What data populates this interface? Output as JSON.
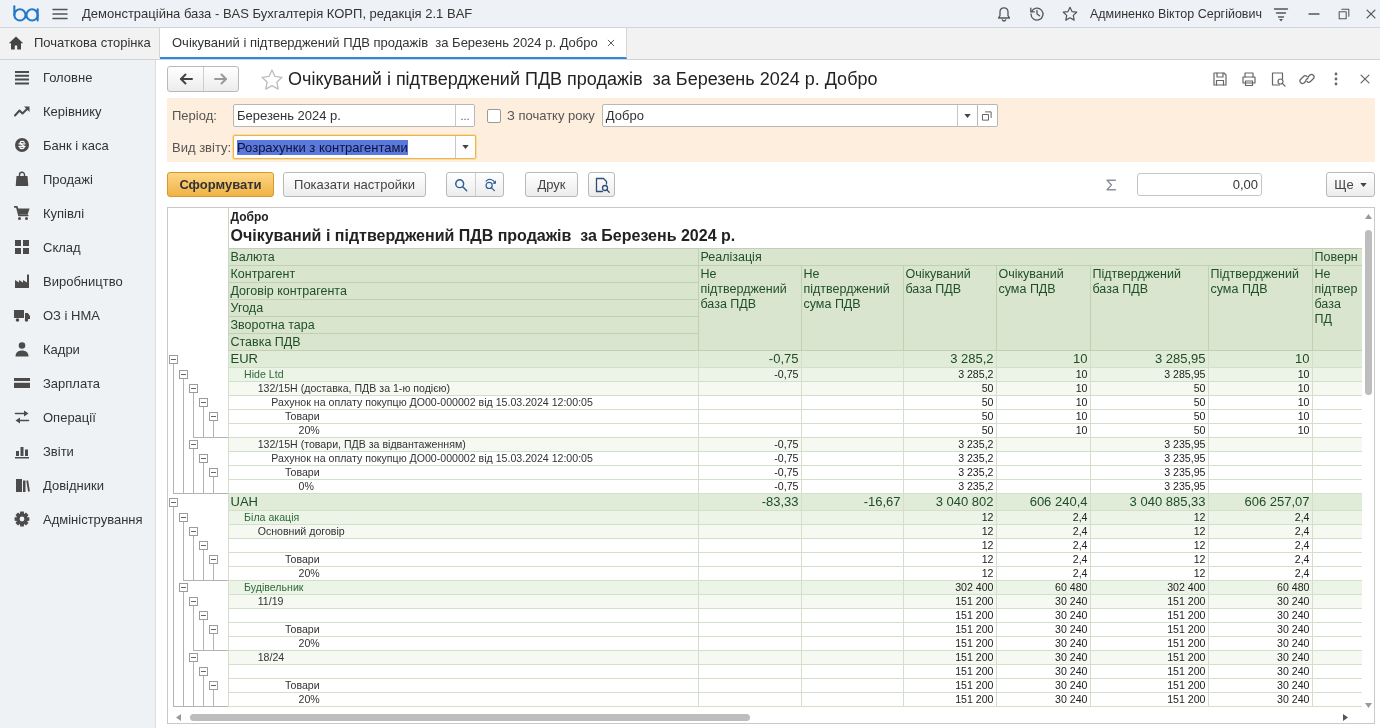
{
  "app_bar": {
    "title": "Демонстраційна база - BAS Бухгалтерія КОРП, редакція 2.1 BAF",
    "user": "Админенко Віктор Сергійович"
  },
  "tabs": [
    {
      "label": "Початкова сторінка",
      "kind": "home",
      "selected": false
    },
    {
      "label": "Очікуваний і підтверджений ПДВ продажів  за Березень 2024 р. Добро",
      "kind": "document",
      "selected": true
    }
  ],
  "sidebar": {
    "items": [
      "Головне",
      "Керівнику",
      "Банк і каса",
      "Продажі",
      "Купівлі",
      "Склад",
      "Виробництво",
      "ОЗ і НМА",
      "Кадри",
      "Зарплата",
      "Операції",
      "Звіти",
      "Довідники",
      "Адміністрування"
    ]
  },
  "form": {
    "title": "Очікуваний і підтверджений ПДВ продажів  за Березень 2024 р. Добро",
    "favorite": false
  },
  "settings": {
    "period": {
      "label": "Період:",
      "value": "Березень 2024 р.",
      "button": "..."
    },
    "from_year_start": {
      "label": "З початку року",
      "checked": false
    },
    "organization": {
      "value": "Добро"
    },
    "report_kind": {
      "label": "Вид звіту:",
      "value": "Розрахунки з контрагентами",
      "focused": true
    }
  },
  "toolbar": {
    "generate_button": "Сформувати",
    "settings_button": "Показати настройки",
    "print_button": "Друк",
    "sum_value": "0,00",
    "more_button": "Ще"
  },
  "report": {
    "organization": "Добро",
    "title": "Очікуваний і підтверджений ПДВ продажів  за Березень 2024 р.",
    "grouping_headers": [
      "Валюта",
      "Контрагент",
      "Договір контрагента",
      "Угода",
      "Зворотна тара",
      "Ставка ПДВ"
    ],
    "column_groups": [
      {
        "label": "Реалізація",
        "columns": [
          "Не підтверджений база ПДВ",
          "Не підтверджений сума ПДВ",
          "Очікуваний база ПДВ",
          "Очікуваний сума ПДВ",
          "Підтверджений база ПДВ",
          "Підтверджений сума ПДВ"
        ]
      },
      {
        "label": "Поверн",
        "columns": [
          "Не підтвер база ПД"
        ]
      }
    ],
    "rows": [
      {
        "label": "EUR",
        "not_confirmed_base": "-0,75",
        "expected_base": "3 285,2",
        "expected_vat": "10",
        "confirmed_base": "3 285,95",
        "confirmed_vat": "10",
        "expanded": true,
        "children": [
          {
            "label": "Hide Ltd",
            "not_confirmed_base": "-0,75",
            "expected_base": "3 285,2",
            "expected_vat": "10",
            "confirmed_base": "3 285,95",
            "confirmed_vat": "10",
            "expanded": true,
            "children": [
              {
                "label": "132/15Н (доставка, ПДВ за 1-ю подією)",
                "expected_base": "50",
                "expected_vat": "10",
                "confirmed_base": "50",
                "confirmed_vat": "10",
                "expanded": true,
                "children": [
                  {
                    "label": "Рахунок на оплату покупцю ДО00-000002 від 15.03.2024 12:00:05",
                    "expected_base": "50",
                    "expected_vat": "10",
                    "confirmed_base": "50",
                    "confirmed_vat": "10",
                    "expanded": true,
                    "children": [
                      {
                        "label": "Товари",
                        "expected_base": "50",
                        "expected_vat": "10",
                        "confirmed_base": "50",
                        "confirmed_vat": "10",
                        "expanded": true,
                        "children": [
                          {
                            "label": "20%",
                            "expected_base": "50",
                            "expected_vat": "10",
                            "confirmed_base": "50",
                            "confirmed_vat": "10"
                          }
                        ]
                      }
                    ]
                  }
                ]
              },
              {
                "label": "132/15Н (товари, ПДВ за відвантаженням)",
                "not_confirmed_base": "-0,75",
                "expected_base": "3 235,2",
                "confirmed_base": "3 235,95",
                "expanded": true,
                "children": [
                  {
                    "label": "Рахунок на оплату покупцю ДО00-000002 від 15.03.2024 12:00:05",
                    "not_confirmed_base": "-0,75",
                    "expected_base": "3 235,2",
                    "confirmed_base": "3 235,95",
                    "expanded": true,
                    "children": [
                      {
                        "label": "Товари",
                        "not_confirmed_base": "-0,75",
                        "expected_base": "3 235,2",
                        "confirmed_base": "3 235,95",
                        "expanded": true,
                        "children": [
                          {
                            "label": "0%",
                            "not_confirmed_base": "-0,75",
                            "expected_base": "3 235,2",
                            "confirmed_base": "3 235,95"
                          }
                        ]
                      }
                    ]
                  }
                ]
              }
            ]
          }
        ]
      },
      {
        "label": "UAH",
        "not_confirmed_base": "-83,33",
        "not_confirmed_vat": "-16,67",
        "expected_base": "3 040 802",
        "expected_vat": "606 240,4",
        "confirmed_base": "3 040 885,33",
        "confirmed_vat": "606 257,07",
        "expanded": true,
        "children": [
          {
            "label": "Біла акація",
            "expected_base": "12",
            "expected_vat": "2,4",
            "confirmed_base": "12",
            "confirmed_vat": "2,4",
            "expanded": true,
            "children": [
              {
                "label": "Основний договір",
                "expected_base": "12",
                "expected_vat": "2,4",
                "confirmed_base": "12",
                "confirmed_vat": "2,4",
                "expanded": true,
                "children": [
                  {
                    "expected_base": "12",
                    "expected_vat": "2,4",
                    "confirmed_base": "12",
                    "confirmed_vat": "2,4",
                    "expanded": true,
                    "children": [
                      {
                        "label": "Товари",
                        "expected_base": "12",
                        "expected_vat": "2,4",
                        "confirmed_base": "12",
                        "confirmed_vat": "2,4",
                        "expanded": true,
                        "children": [
                          {
                            "label": "20%",
                            "expected_base": "12",
                            "expected_vat": "2,4",
                            "confirmed_base": "12",
                            "confirmed_vat": "2,4"
                          }
                        ]
                      }
                    ]
                  }
                ]
              }
            ]
          },
          {
            "label": "Будівельник",
            "expected_base": "302 400",
            "expected_vat": "60 480",
            "confirmed_base": "302 400",
            "confirmed_vat": "60 480",
            "expanded": true,
            "children": [
              {
                "label": "11/19",
                "expected_base": "151 200",
                "expected_vat": "30 240",
                "confirmed_base": "151 200",
                "confirmed_vat": "30 240",
                "expanded": true,
                "children": [
                  {
                    "expected_base": "151 200",
                    "expected_vat": "30 240",
                    "confirmed_base": "151 200",
                    "confirmed_vat": "30 240",
                    "expanded": true,
                    "children": [
                      {
                        "label": "Товари",
                        "expected_base": "151 200",
                        "expected_vat": "30 240",
                        "confirmed_base": "151 200",
                        "confirmed_vat": "30 240",
                        "expanded": true,
                        "children": [
                          {
                            "label": "20%",
                            "expected_base": "151 200",
                            "expected_vat": "30 240",
                            "confirmed_base": "151 200",
                            "confirmed_vat": "30 240"
                          }
                        ]
                      }
                    ]
                  }
                ]
              },
              {
                "label": "18/24",
                "expected_base": "151 200",
                "expected_vat": "30 240",
                "confirmed_base": "151 200",
                "confirmed_vat": "30 240",
                "expanded": true,
                "children": [
                  {
                    "expected_base": "151 200",
                    "expected_vat": "30 240",
                    "confirmed_base": "151 200",
                    "confirmed_vat": "30 240",
                    "expanded": true,
                    "children": [
                      {
                        "label": "Товари",
                        "expected_base": "151 200",
                        "expected_vat": "30 240",
                        "confirmed_base": "151 200",
                        "confirmed_vat": "30 240",
                        "expanded": true,
                        "children": [
                          {
                            "label": "20%",
                            "expected_base": "151 200",
                            "expected_vat": "30 240",
                            "confirmed_base": "151 200",
                            "confirmed_vat": "30 240"
                          }
                        ]
                      }
                    ]
                  }
                ]
              }
            ]
          }
        ]
      }
    ]
  }
}
